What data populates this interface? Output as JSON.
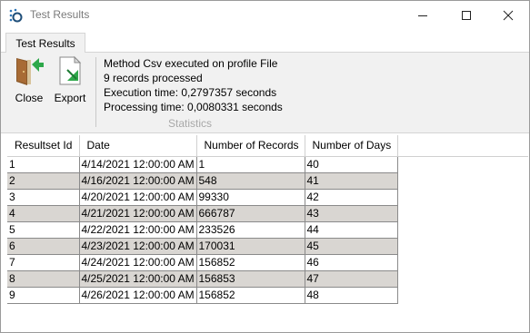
{
  "window": {
    "title": "Test Results"
  },
  "tabs": [
    {
      "label": "Test Results"
    }
  ],
  "ribbon": {
    "buttons": [
      {
        "label": "Close",
        "icon": "exit-door-icon"
      },
      {
        "label": "Export",
        "icon": "export-document-icon"
      }
    ],
    "stats": {
      "lines": [
        "Method Csv executed on profile File",
        "9 records processed",
        "Execution time: 0,2797357 seconds",
        "Processing time: 0,0080331 seconds"
      ],
      "caption": "Statistics"
    }
  },
  "grid": {
    "columns": [
      "Resultset Id",
      "Date",
      "Number of Records",
      "Number of Days"
    ],
    "rows": [
      [
        "1",
        "4/14/2021 12:00:00 AM",
        "1",
        "40"
      ],
      [
        "2",
        "4/16/2021 12:00:00 AM",
        "548",
        "41"
      ],
      [
        "3",
        "4/20/2021 12:00:00 AM",
        "99330",
        "42"
      ],
      [
        "4",
        "4/21/2021 12:00:00 AM",
        "666787",
        "43"
      ],
      [
        "5",
        "4/22/2021 12:00:00 AM",
        "233526",
        "44"
      ],
      [
        "6",
        "4/23/2021 12:00:00 AM",
        "170031",
        "45"
      ],
      [
        "7",
        "4/24/2021 12:00:00 AM",
        "156852",
        "46"
      ],
      [
        "8",
        "4/25/2021 12:00:00 AM",
        "156853",
        "47"
      ],
      [
        "9",
        "4/26/2021 12:00:00 AM",
        "156852",
        "48"
      ]
    ]
  },
  "colors": {
    "alt_row": "#d9d6d2",
    "ribbon_bg": "#f1f1f1",
    "caption_gray": "#a8a8a8"
  }
}
